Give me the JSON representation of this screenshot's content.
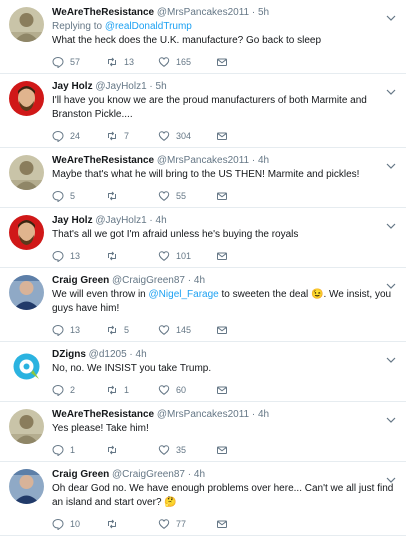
{
  "tweets": [
    {
      "avatar": "wearetheresistance-avatar",
      "name": "WeAreTheResistance",
      "handle": "@MrsPancakes2011",
      "time": "5h",
      "replying_label": "Replying to",
      "replying_to": "@realDonaldTrump",
      "text_before": "What the heck does the U.K. manufacture? Go back to sleep",
      "link": "",
      "text_after": "",
      "emoji": "",
      "replies": "57",
      "retweets": "13",
      "likes": "165"
    },
    {
      "avatar": "jayholz-avatar",
      "name": "Jay Holz",
      "handle": "@JayHolz1",
      "time": "5h",
      "replying_label": "",
      "replying_to": "",
      "text_before": "I'll have you know we are the proud manufacturers of both Marmite and Branston Pickle....",
      "link": "",
      "text_after": "",
      "emoji": "",
      "replies": "24",
      "retweets": "7",
      "likes": "304"
    },
    {
      "avatar": "wearetheresistance-avatar",
      "name": "WeAreTheResistance",
      "handle": "@MrsPancakes2011",
      "time": "4h",
      "replying_label": "",
      "replying_to": "",
      "text_before": "Maybe that's what he will bring to the US THEN! Marmite and pickles!",
      "link": "",
      "text_after": "",
      "emoji": "",
      "replies": "5",
      "retweets": "",
      "likes": "55"
    },
    {
      "avatar": "jayholz-avatar",
      "name": "Jay Holz",
      "handle": "@JayHolz1",
      "time": "4h",
      "replying_label": "",
      "replying_to": "",
      "text_before": "That's all we got I'm afraid unless he's buying the royals",
      "link": "",
      "text_after": "",
      "emoji": "",
      "replies": "13",
      "retweets": "",
      "likes": "101"
    },
    {
      "avatar": "craiggreen-avatar",
      "name": "Craig Green",
      "handle": "@CraigGreen87",
      "time": "4h",
      "replying_label": "",
      "replying_to": "",
      "text_before": "We will even throw in ",
      "link": "@Nigel_Farage",
      "text_after": " to sweeten the deal 😉. We insist, you guys have him!",
      "emoji": "",
      "replies": "13",
      "retweets": "5",
      "likes": "145"
    },
    {
      "avatar": "dzigns-avatar",
      "name": "DZigns",
      "handle": "@d1205",
      "time": "4h",
      "replying_label": "",
      "replying_to": "",
      "text_before": "No, no. We INSIST you take Trump.",
      "link": "",
      "text_after": "",
      "emoji": "",
      "replies": "2",
      "retweets": "1",
      "likes": "60"
    },
    {
      "avatar": "wearetheresistance-avatar",
      "name": "WeAreTheResistance",
      "handle": "@MrsPancakes2011",
      "time": "4h",
      "replying_label": "",
      "replying_to": "",
      "text_before": "Yes please! Take him!",
      "link": "",
      "text_after": "",
      "emoji": "",
      "replies": "1",
      "retweets": "",
      "likes": "35"
    },
    {
      "avatar": "craiggreen-avatar",
      "name": "Craig Green",
      "handle": "@CraigGreen87",
      "time": "4h",
      "replying_label": "",
      "replying_to": "",
      "text_before": "Oh dear God no. We have enough problems over here... Can't we all just find an island and start over? 🤔",
      "link": "",
      "text_after": "",
      "emoji": "",
      "replies": "10",
      "retweets": "",
      "likes": "77"
    }
  ],
  "colors": {
    "link": "#1da1f2",
    "muted": "#657786",
    "text": "#14171a",
    "divider": "#e6ecf0"
  }
}
